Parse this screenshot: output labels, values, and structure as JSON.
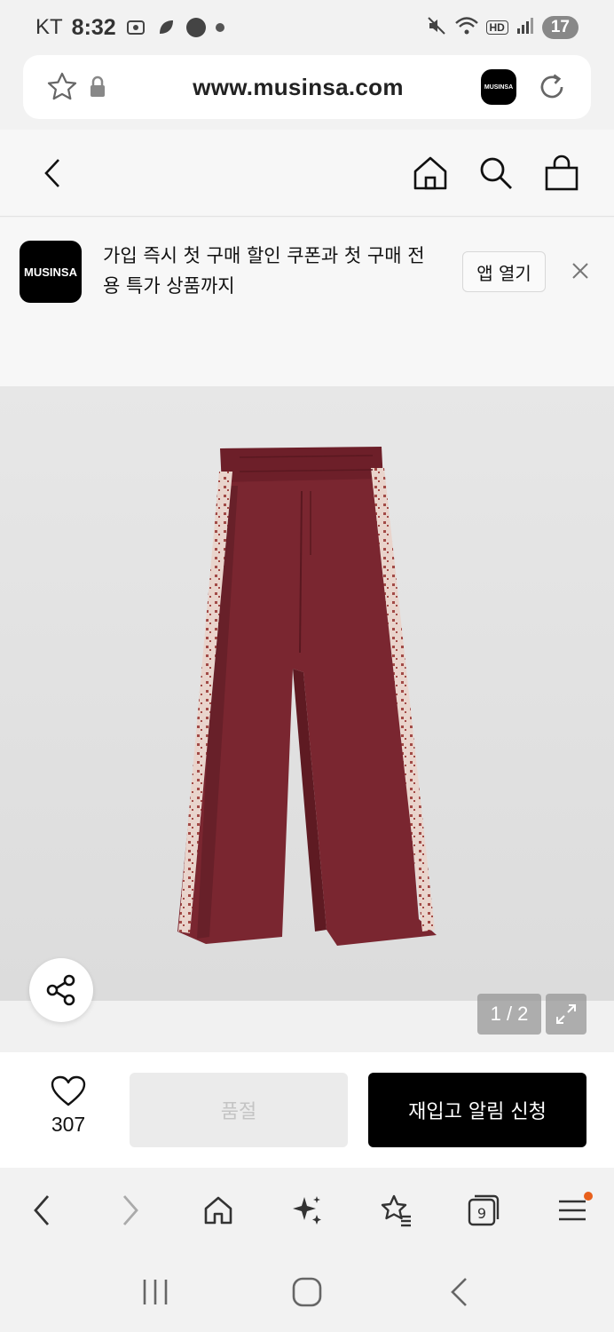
{
  "status_bar": {
    "carrier": "KT",
    "time": "8:32",
    "battery": "17",
    "hd_label": "HD"
  },
  "address_bar": {
    "url": "www.musinsa.com",
    "site_badge": "MUSINSA"
  },
  "app_banner": {
    "logo_text": "MUSINSA",
    "text": "가입 즉시 첫 구매 할인 쿠폰과 첫 구매 전용 특가 상품까지",
    "open_app_label": "앱 열기"
  },
  "product": {
    "image_alt": "burgundy track pants",
    "page_indicator": "1 / 2",
    "pants_color": "#7a2630"
  },
  "purchase_bar": {
    "like_count": "307",
    "soldout_label": "품절",
    "restock_label": "재입고 알림 신청"
  },
  "colors": {
    "accent_black": "#000000",
    "notification_dot": "#e8601c"
  }
}
